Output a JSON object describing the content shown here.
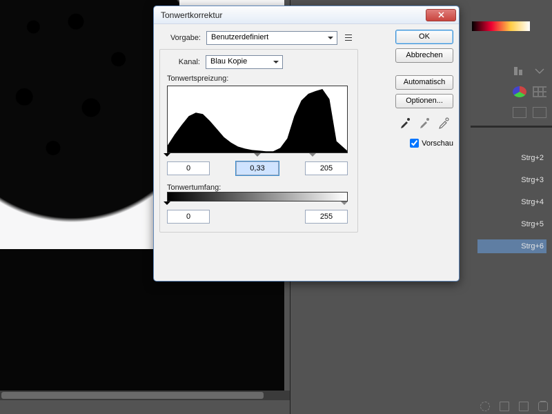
{
  "dialog": {
    "title": "Tonwertkorrektur",
    "preset_label": "Vorgabe:",
    "preset_value": "Benutzerdefiniert",
    "channel_label": "Kanal:",
    "channel_value": "Blau Kopie",
    "input_section_label": "Tonwertspreizung:",
    "input_black": "0",
    "input_gamma": "0,33",
    "input_white": "205",
    "output_section_label": "Tonwertumfang:",
    "output_black": "0",
    "output_white": "255",
    "buttons": {
      "ok": "OK",
      "cancel": "Abbrechen",
      "auto": "Automatisch",
      "options": "Optionen..."
    },
    "preview_label": "Vorschau",
    "preview_checked": true
  },
  "right_panel": {
    "channel_shortcuts": [
      {
        "label": "Strg+2",
        "selected": false
      },
      {
        "label": "Strg+3",
        "selected": false
      },
      {
        "label": "Strg+4",
        "selected": false
      },
      {
        "label": "Strg+5",
        "selected": false
      },
      {
        "label": "Strg+6",
        "selected": true
      }
    ]
  },
  "chart_data": {
    "type": "area",
    "title": "Tonwertspreizung:",
    "xlabel": "",
    "ylabel": "",
    "x": [
      0,
      10,
      20,
      30,
      40,
      50,
      60,
      70,
      80,
      90,
      100,
      110,
      120,
      130,
      140,
      150,
      160,
      170,
      180,
      190,
      200,
      210,
      220,
      230,
      240,
      255
    ],
    "values": [
      12,
      28,
      42,
      55,
      60,
      58,
      48,
      36,
      24,
      16,
      10,
      7,
      5,
      4,
      3,
      3,
      8,
      22,
      55,
      78,
      88,
      92,
      95,
      80,
      18,
      4
    ],
    "xlim": [
      0,
      255
    ],
    "ylim": [
      0,
      100
    ],
    "markers": {
      "black": 0,
      "gamma": 0.33,
      "white": 205
    }
  }
}
